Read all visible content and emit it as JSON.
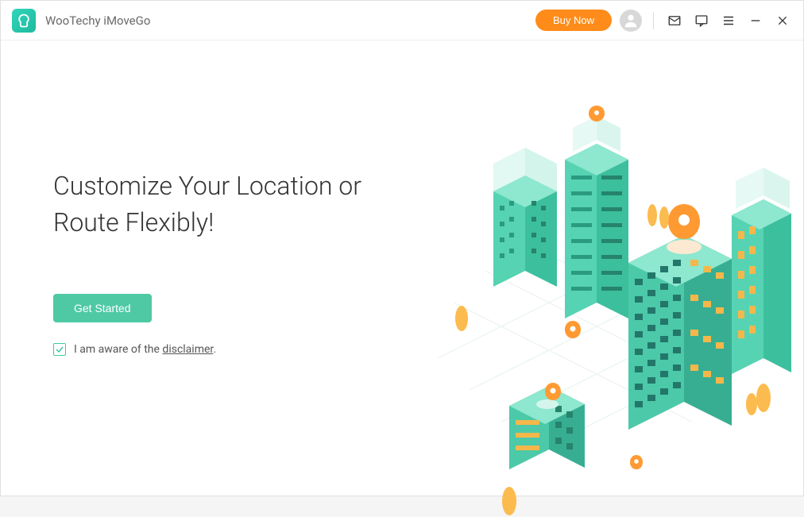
{
  "header": {
    "app_title": "WooTechy iMoveGo",
    "buy_now_label": "Buy Now",
    "icons": {
      "logo": "G-logo",
      "avatar": "user-avatar",
      "mail": "mail-icon",
      "feedback": "feedback-icon",
      "menu": "menu-icon",
      "minimize": "minimize-icon",
      "close": "close-icon"
    }
  },
  "main": {
    "headline": "Customize Your Location or Route Flexibly!",
    "get_started_label": "Get Started",
    "disclaimer_prefix": "I am aware of the ",
    "disclaimer_link": "disclaimer",
    "disclaimer_suffix": ".",
    "disclaimer_checked": true
  },
  "colors": {
    "accent_green": "#4ec9a4",
    "accent_orange": "#ff8c1a",
    "pin_orange": "#ff9a33"
  }
}
